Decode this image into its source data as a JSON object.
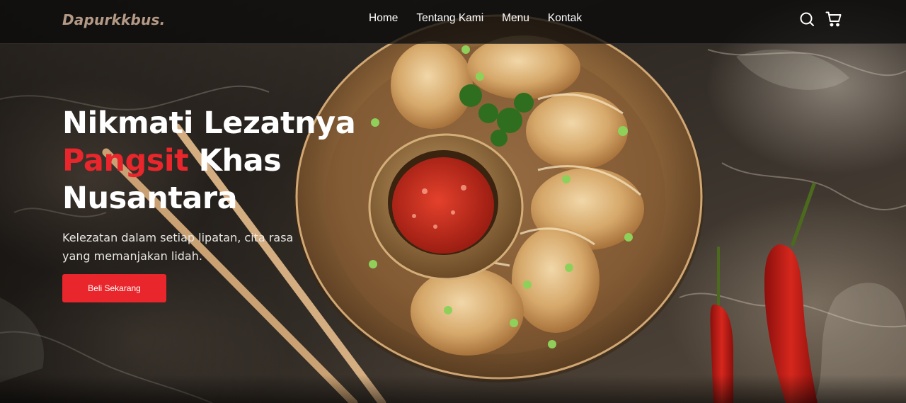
{
  "brand": {
    "name": "Dapurkkbus."
  },
  "nav": {
    "links": [
      {
        "label": "Home"
      },
      {
        "label": "Tentang Kami"
      },
      {
        "label": "Menu"
      },
      {
        "label": "Kontak"
      }
    ],
    "icons": [
      "search-icon",
      "shopping-cart-icon"
    ]
  },
  "hero": {
    "title_line1": "Nikmati Lezatnya",
    "title_accent": "Pangsit",
    "title_after_accent": " Khas",
    "title_line3": "Nusantara",
    "subtitle": "Kelezatan dalam setiap lipatan, cita rasa yang memanjakan lidah.",
    "cta_label": "Beli Sekarang"
  },
  "colors": {
    "accent": "#e8262b",
    "brand_text": "#b49a86",
    "navbar_bg": "#0a0a0a"
  }
}
